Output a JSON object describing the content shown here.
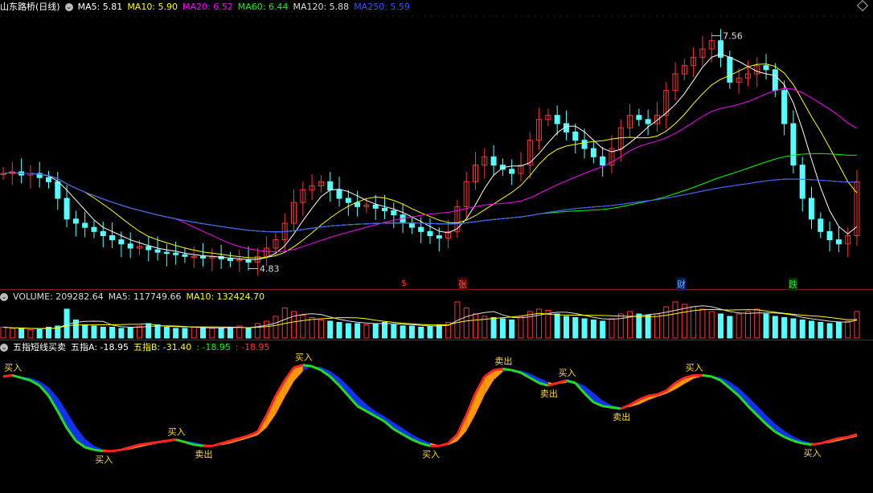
{
  "main_panel": {
    "title": "山东路桥(日线)",
    "indicators": [
      {
        "label": "MA5: 5.81",
        "color": "#ffffff"
      },
      {
        "label": "MA10: 5.90",
        "color": "#ffff00"
      },
      {
        "label": "MA20: 6.52",
        "color": "#ff00ff"
      },
      {
        "label": "MA60: 6.44",
        "color": "#00ff00"
      },
      {
        "label": "MA120: 5.88",
        "color": "#dddddd"
      },
      {
        "label": "MA250: 5.59",
        "color": "#3355ff"
      }
    ],
    "high_label": "7.56",
    "low_label": "4.83",
    "events": [
      {
        "label": "$",
        "color": "#ff3333"
      },
      {
        "label": "张",
        "color": "#ff5555"
      },
      {
        "label": "财",
        "color": "#66aaff"
      },
      {
        "label": "跌",
        "color": "#33dd33"
      }
    ]
  },
  "volume_panel": {
    "indicators": [
      {
        "label": "VOLUME: 209282.64",
        "color": "#dddddd"
      },
      {
        "label": "MA5: 117749.66",
        "color": "#dddddd"
      },
      {
        "label": "MA10: 132424.70",
        "color": "#ffff00"
      }
    ]
  },
  "signal_panel": {
    "title": "五指短线买卖",
    "indicators": [
      {
        "label": "五指A: -18.95",
        "color": "#ffffff"
      },
      {
        "label": "五指B: -31.40",
        "color": "#ffff00"
      },
      {
        "label": ": -18.95",
        "color": "#00ff00"
      },
      {
        "label": ": -18.95",
        "color": "#ff3333"
      }
    ],
    "buy_label": "买入",
    "sell_label": "卖出",
    "signals": [
      {
        "type": "buy",
        "label": "买入"
      },
      {
        "type": "buy",
        "label": "买入"
      },
      {
        "type": "buy",
        "label": "买入"
      },
      {
        "type": "sell",
        "label": "卖出"
      },
      {
        "type": "buy",
        "label": "买入"
      },
      {
        "type": "buy",
        "label": "买入"
      },
      {
        "type": "sell",
        "label": "卖出"
      },
      {
        "type": "sell",
        "label": "卖出"
      },
      {
        "type": "buy",
        "label": "买入"
      },
      {
        "type": "sell",
        "label": "卖出"
      },
      {
        "type": "buy",
        "label": "买入"
      },
      {
        "type": "buy",
        "label": "买入"
      }
    ]
  },
  "chart_data": {
    "type": "candlestick",
    "title": "山东路桥(日线)",
    "high": 7.56,
    "low": 4.83,
    "price_series": [
      5.9,
      5.92,
      5.88,
      5.9,
      5.85,
      5.8,
      5.6,
      5.35,
      5.3,
      5.25,
      5.2,
      5.15,
      5.1,
      5.05,
      5.0,
      5.02,
      4.98,
      4.95,
      4.94,
      4.92,
      4.9,
      4.9,
      4.88,
      4.9,
      4.87,
      4.85,
      4.86,
      4.83,
      4.9,
      5.0,
      5.1,
      5.3,
      5.55,
      5.7,
      5.75,
      5.8,
      5.7,
      5.6,
      5.55,
      5.5,
      5.52,
      5.48,
      5.45,
      5.4,
      5.3,
      5.25,
      5.2,
      5.15,
      5.12,
      5.2,
      5.5,
      5.8,
      6.0,
      6.1,
      6.0,
      5.95,
      5.9,
      6.0,
      6.3,
      6.55,
      6.6,
      6.5,
      6.4,
      6.3,
      6.2,
      6.1,
      6.0,
      6.2,
      6.45,
      6.6,
      6.55,
      6.5,
      6.6,
      6.9,
      7.1,
      7.2,
      7.3,
      7.4,
      7.5,
      7.3,
      7.0,
      7.05,
      7.1,
      7.2,
      7.15,
      6.9,
      6.5,
      6.0,
      5.6,
      5.35,
      5.2,
      5.1,
      5.05,
      5.15,
      5.8
    ],
    "volume_series": [
      9,
      8,
      8,
      7,
      7,
      9,
      10,
      24,
      15,
      11,
      10,
      9,
      9,
      8,
      9,
      10,
      12,
      11,
      9,
      8,
      8,
      9,
      9,
      8,
      8,
      9,
      10,
      8,
      12,
      14,
      18,
      25,
      22,
      19,
      17,
      15,
      14,
      13,
      12,
      12,
      11,
      12,
      13,
      11,
      10,
      10,
      9,
      10,
      11,
      13,
      30,
      25,
      20,
      18,
      17,
      16,
      15,
      18,
      22,
      24,
      23,
      20,
      18,
      17,
      16,
      15,
      14,
      16,
      20,
      22,
      20,
      19,
      20,
      26,
      30,
      28,
      26,
      24,
      22,
      20,
      18,
      20,
      22,
      24,
      20,
      18,
      17,
      16,
      15,
      14,
      13,
      12,
      13,
      14,
      22
    ],
    "signal_series": [
      85,
      86,
      84,
      82,
      78,
      70,
      58,
      45,
      35,
      30,
      28,
      27,
      27,
      28,
      30,
      32,
      33,
      34,
      35,
      36,
      34,
      32,
      31,
      31,
      33,
      35,
      37,
      39,
      42,
      55,
      70,
      82,
      92,
      94,
      93,
      90,
      85,
      78,
      70,
      62,
      58,
      54,
      50,
      44,
      40,
      36,
      33,
      31,
      31,
      33,
      40,
      55,
      72,
      85,
      90,
      91,
      90,
      88,
      84,
      80,
      78,
      80,
      82,
      80,
      72,
      65,
      62,
      61,
      60,
      63,
      67,
      70,
      71,
      74,
      80,
      84,
      86,
      86,
      85,
      82,
      76,
      70,
      62,
      55,
      48,
      42,
      38,
      35,
      33,
      32,
      33,
      35,
      37,
      38,
      40
    ],
    "ylabel": "",
    "xlabel": ""
  }
}
